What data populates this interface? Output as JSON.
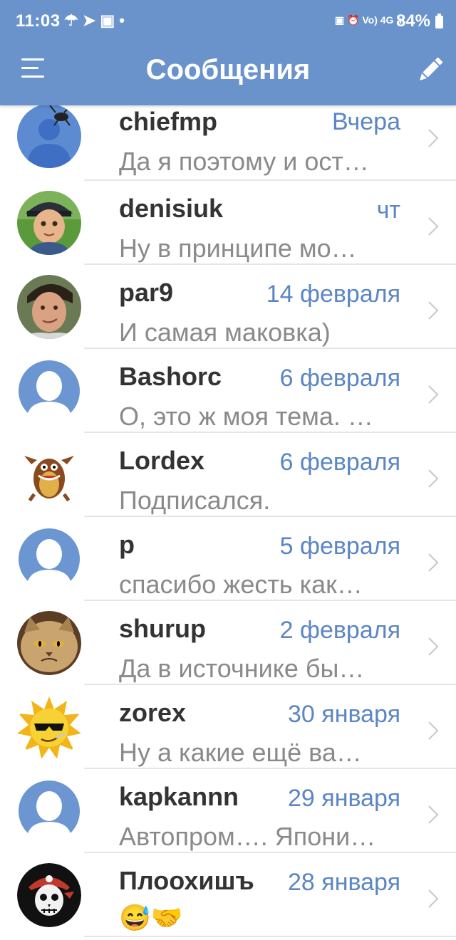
{
  "status_bar": {
    "time": "11:03",
    "left_icons": "☂ ➤ ▣ •",
    "right_icons": "▣ ⏰ Vo) 4G .ıl",
    "battery": "84%"
  },
  "header": {
    "title": "Сообщения",
    "menu_icon": "menu-icon",
    "compose_icon": "pencil-icon"
  },
  "colors": {
    "header_bg": "#6a93cc",
    "date_text": "#5b86c4",
    "name_text": "#333333",
    "preview_text": "#8a8a8a"
  },
  "conversations": [
    {
      "name": "chiefmp",
      "date": "Вчера",
      "preview": "Да я поэтому и ост…",
      "avatar": "default-with-fly"
    },
    {
      "name": "denisiuk",
      "date": "чт",
      "preview": "Ну в принципе мо…",
      "avatar": "cartoon-boy"
    },
    {
      "name": "par9",
      "date": "14 февраля",
      "preview": "И самая маковка)",
      "avatar": "photo-face"
    },
    {
      "name": "Bashorc",
      "date": "6 февраля",
      "preview": "О, это ж моя тема. …",
      "avatar": "default"
    },
    {
      "name": "Lordex",
      "date": "6 февраля",
      "preview": "Подписался.",
      "avatar": "tasmanian-devil"
    },
    {
      "name": "p",
      "date": "5 февраля",
      "preview": "спасибо жесть как…",
      "avatar": "default"
    },
    {
      "name": "shurup",
      "date": "2 февраля",
      "preview": "Да в источнике бы…",
      "avatar": "grumpy-cat"
    },
    {
      "name": "zorex",
      "date": "30 января",
      "preview": "Ну а какие ещё ва…",
      "avatar": "sun-sunglasses"
    },
    {
      "name": "kapkannn",
      "date": "29 января",
      "preview": "Автопром…. Япони…",
      "avatar": "default"
    },
    {
      "name": "Плоохишъ",
      "date": "28 января",
      "preview": "😅🤝",
      "avatar": "pirate-skull"
    }
  ]
}
